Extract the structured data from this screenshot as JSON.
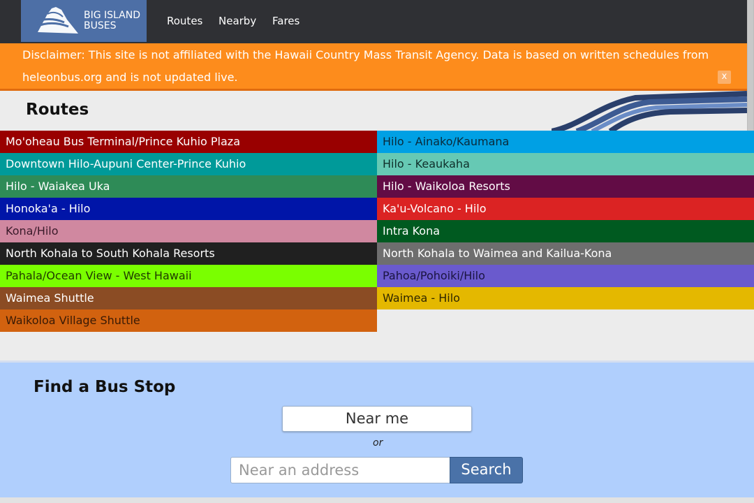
{
  "brand": {
    "line1": "BIG ISLAND",
    "line2": "BUSES",
    "color": "#4d6fa6"
  },
  "nav": {
    "links": [
      "Routes",
      "Nearby",
      "Fares"
    ]
  },
  "disclaimer": {
    "text": "Disclaimer: This site is not affiliated with the Hawaii Country Mass Transit Agency. Data is based on written schedules from heleonbus.org and is not updated live.",
    "close_label": "x",
    "color": "#fd8c1c"
  },
  "routes": {
    "title": "Routes",
    "items": [
      {
        "name": "Mo'oheau Bus Terminal/Prince Kuhio Plaza",
        "color": "#990000",
        "text_color": "#ffffff"
      },
      {
        "name": "Hilo - Ainako/Kaumana",
        "color": "#00a0e4",
        "text_color": "#0a2a3a"
      },
      {
        "name": "Downtown Hilo-Aupuni Center-Prince Kuhio",
        "color": "#009a99",
        "text_color": "#ffffff"
      },
      {
        "name": "Hilo - Keaukaha",
        "color": "#66c9b4",
        "text_color": "#0f2f2a"
      },
      {
        "name": "Hilo - Waiakea Uka",
        "color": "#2e8b57",
        "text_color": "#ffffff"
      },
      {
        "name": "Hilo - Waikoloa Resorts",
        "color": "#620c45",
        "text_color": "#ffffff"
      },
      {
        "name": "Honoka'a - Hilo",
        "color": "#0015a8",
        "text_color": "#ffffff"
      },
      {
        "name": "Ka'u-Volcano - Hilo",
        "color": "#db2323",
        "text_color": "#ffffff"
      },
      {
        "name": "Kona/Hilo",
        "color": "#d088a0",
        "text_color": "#3a1a2a"
      },
      {
        "name": "Intra Kona",
        "color": "#005a20",
        "text_color": "#ffffff"
      },
      {
        "name": "North Kohala to South Kohala Resorts",
        "color": "#202020",
        "text_color": "#ffffff"
      },
      {
        "name": "North Kohala to Waimea and Kailua-Kona",
        "color": "#6e6e6e",
        "text_color": "#ffffff"
      },
      {
        "name": "Pahala/Ocean View - West Hawaii",
        "color": "#7aff00",
        "text_color": "#1f3a00"
      },
      {
        "name": "Pahoa/Pohoiki/Hilo",
        "color": "#6a5acd",
        "text_color": "#1a1440"
      },
      {
        "name": "Waimea Shuttle",
        "color": "#8b4c24",
        "text_color": "#ffffff"
      },
      {
        "name": "Waimea - Hilo",
        "color": "#e4b800",
        "text_color": "#2f2600"
      },
      {
        "name": "Waikoloa Village Shuttle",
        "color": "#d2620f",
        "text_color": "#3a1a05"
      }
    ]
  },
  "find": {
    "title": "Find a Bus Stop",
    "near_me_label": "Near me",
    "or_label": "or",
    "address_placeholder": "Near an address",
    "address_value": "",
    "search_label": "Search"
  }
}
